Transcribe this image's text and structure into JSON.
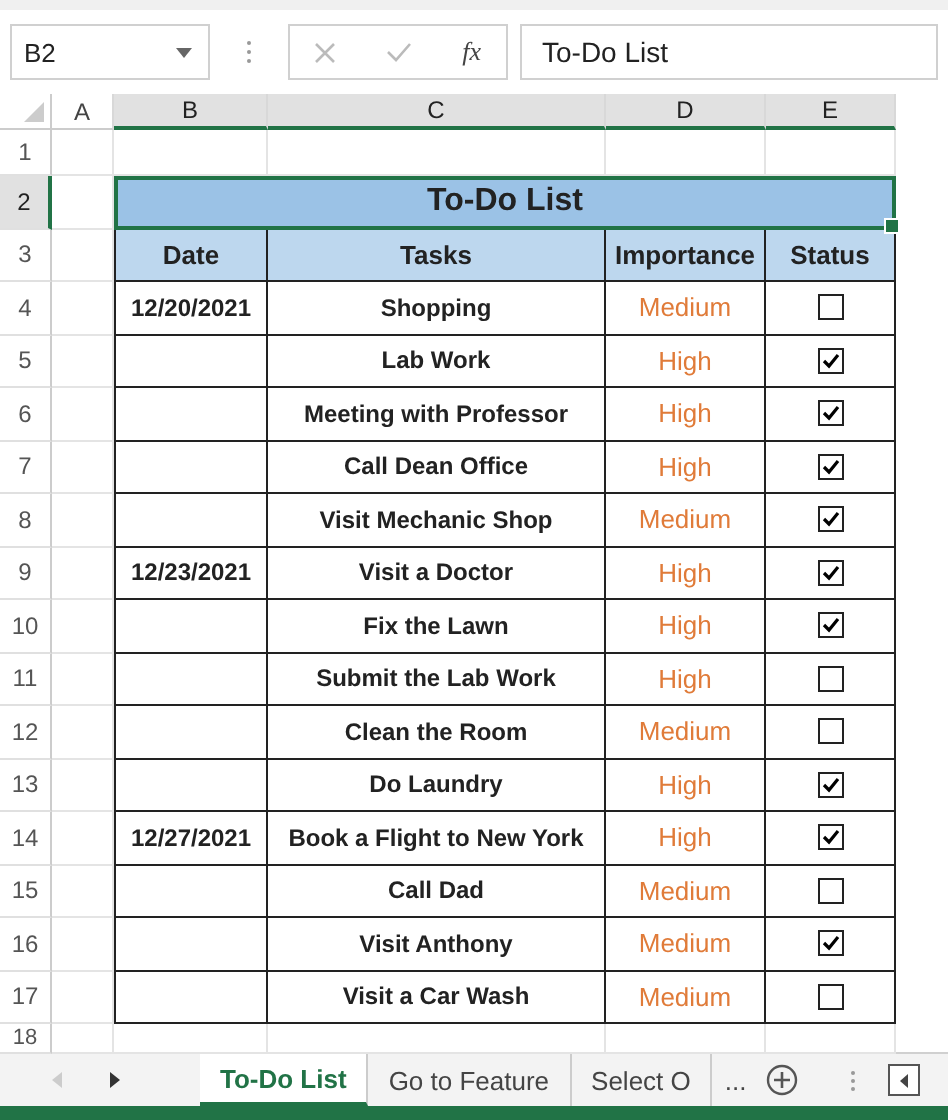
{
  "name_box": "B2",
  "formula_bar": {
    "fx_label": "fx",
    "value": "To-Do List"
  },
  "column_headers": [
    {
      "label": "A",
      "selected": false
    },
    {
      "label": "B",
      "selected": true
    },
    {
      "label": "C",
      "selected": true
    },
    {
      "label": "D",
      "selected": true
    },
    {
      "label": "E",
      "selected": true
    }
  ],
  "sheet": {
    "row_1": {
      "row": "1",
      "selected": false
    },
    "title_row": {
      "row": "2",
      "selected": true,
      "text": "To-Do List"
    },
    "header_row": {
      "row": "3",
      "selected": false,
      "columns": [
        "Date",
        "Tasks",
        "Importance",
        "Status"
      ]
    },
    "rows": [
      {
        "row": "4",
        "selected": false,
        "date": "12/20/2021",
        "task": "Shopping",
        "importance": "Medium",
        "checked": false
      },
      {
        "row": "5",
        "selected": false,
        "task": "Lab Work",
        "importance": "High",
        "checked": true
      },
      {
        "row": "6",
        "selected": false,
        "task": "Meeting with Professor",
        "importance": "High",
        "checked": true
      },
      {
        "row": "7",
        "selected": false,
        "task": "Call Dean Office",
        "importance": "High",
        "checked": true
      },
      {
        "row": "8",
        "selected": false,
        "task": "Visit Mechanic Shop",
        "importance": "Medium",
        "checked": true
      },
      {
        "row": "9",
        "selected": false,
        "date": "12/23/2021",
        "task": "Visit a Doctor",
        "importance": "High",
        "checked": true
      },
      {
        "row": "10",
        "selected": false,
        "task": "Fix the Lawn",
        "importance": "High",
        "checked": true
      },
      {
        "row": "11",
        "selected": false,
        "task": "Submit the Lab Work",
        "importance": "High",
        "checked": false
      },
      {
        "row": "12",
        "selected": false,
        "task": "Clean the Room",
        "importance": "Medium",
        "checked": false
      },
      {
        "row": "13",
        "selected": false,
        "task": "Do Laundry",
        "importance": "High",
        "checked": true
      },
      {
        "row": "14",
        "selected": false,
        "date": "12/27/2021",
        "task": "Book a Flight to New York",
        "importance": "High",
        "checked": true
      },
      {
        "row": "15",
        "selected": false,
        "task": "Call Dad",
        "importance": "Medium",
        "checked": false
      },
      {
        "row": "16",
        "selected": false,
        "task": "Visit Anthony",
        "importance": "Medium",
        "checked": true
      },
      {
        "row": "17",
        "selected": false,
        "task": "Visit a Car Wash",
        "importance": "Medium",
        "checked": false
      }
    ],
    "row_18": {
      "row": "18",
      "selected": false
    }
  },
  "sheet_tabs": [
    {
      "label": "To-Do List",
      "selected": true
    },
    {
      "label": "Go to Feature",
      "selected": false
    },
    {
      "label": "Select O",
      "selected": false
    }
  ],
  "more_tabs_label": "..."
}
